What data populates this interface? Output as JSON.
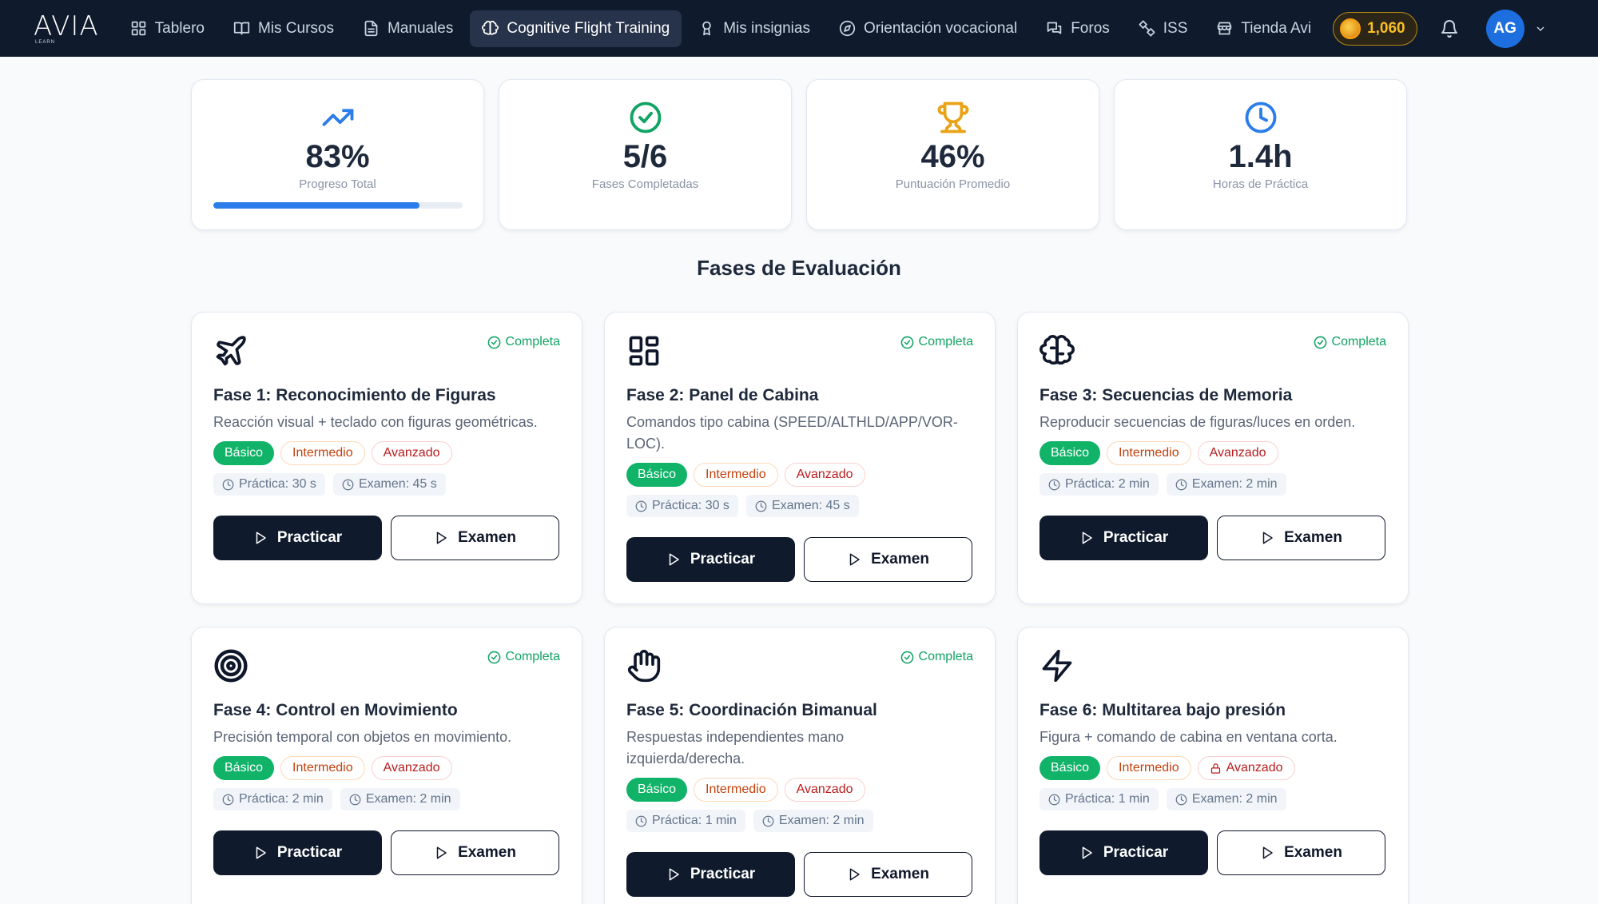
{
  "nav": {
    "logo": "AVIA",
    "logo_sub": "LEARN",
    "items": [
      {
        "label": "Tablero",
        "icon": "dashboard-icon"
      },
      {
        "label": "Mis Cursos",
        "icon": "book-icon"
      },
      {
        "label": "Manuales",
        "icon": "document-icon"
      },
      {
        "label": "Cognitive Flight Training",
        "icon": "brain-icon",
        "active": true
      },
      {
        "label": "Mis insignias",
        "icon": "badge-icon"
      },
      {
        "label": "Orientación vocacional",
        "icon": "compass-icon"
      },
      {
        "label": "Foros",
        "icon": "chat-icon"
      },
      {
        "label": "ISS",
        "icon": "satellite-icon"
      },
      {
        "label": "Tienda Avi",
        "icon": "store-icon"
      }
    ],
    "coins": "1,060",
    "avatar_initials": "AG"
  },
  "stats": [
    {
      "value": "83%",
      "label": "Progreso Total",
      "icon": "trending-up-icon",
      "color": "#2b7de9",
      "progress": 0.83
    },
    {
      "value": "5/6",
      "label": "Fases Completadas",
      "icon": "check-circle-icon",
      "color": "#10a363"
    },
    {
      "value": "46%",
      "label": "Puntuación Promedio",
      "icon": "trophy-icon",
      "color": "#e8a317"
    },
    {
      "value": "1.4h",
      "label": "Horas de Práctica",
      "icon": "clock-icon",
      "color": "#2b7de9"
    }
  ],
  "section_title": "Fases de Evaluación",
  "phases": [
    {
      "title": "Fase 1: Reconocimiento de Figuras",
      "desc": "Reacción visual + teclado con figuras geométricas.",
      "status": "Completa",
      "icon": "airplane-icon",
      "practice": "Práctica: 30 s",
      "exam": "Examen: 45 s"
    },
    {
      "title": "Fase 2: Panel de Cabina",
      "desc": "Comandos tipo cabina (SPEED/ALTHLD/APP/VOR-LOC).",
      "status": "Completa",
      "icon": "grid-icon",
      "practice": "Práctica: 30 s",
      "exam": "Examen: 45 s"
    },
    {
      "title": "Fase 3: Secuencias de Memoria",
      "desc": "Reproducir secuencias de figuras/luces en orden.",
      "status": "Completa",
      "icon": "brain-icon",
      "practice": "Práctica: 2 min",
      "exam": "Examen: 2 min"
    },
    {
      "title": "Fase 4: Control en Movimiento",
      "desc": "Precisión temporal con objetos en movimiento.",
      "status": "Completa",
      "icon": "target-icon",
      "practice": "Práctica: 2 min",
      "exam": "Examen: 2 min"
    },
    {
      "title": "Fase 5: Coordinación Bimanual",
      "desc": "Respuestas independientes mano izquierda/derecha.",
      "status": "Completa",
      "icon": "hand-icon",
      "practice": "Práctica: 1 min",
      "exam": "Examen: 2 min"
    },
    {
      "title": "Fase 6: Multitarea bajo presión",
      "desc": "Figura + comando de cabina en ventana corta.",
      "status": "",
      "icon": "lightning-icon",
      "practice": "Práctica: 1 min",
      "exam": "Examen: 2 min",
      "advanced_locked": true
    }
  ],
  "levels": {
    "basic": "Básico",
    "intermediate": "Intermedio",
    "advanced": "Avanzado"
  },
  "buttons": {
    "practice": "Practicar",
    "exam": "Examen"
  }
}
